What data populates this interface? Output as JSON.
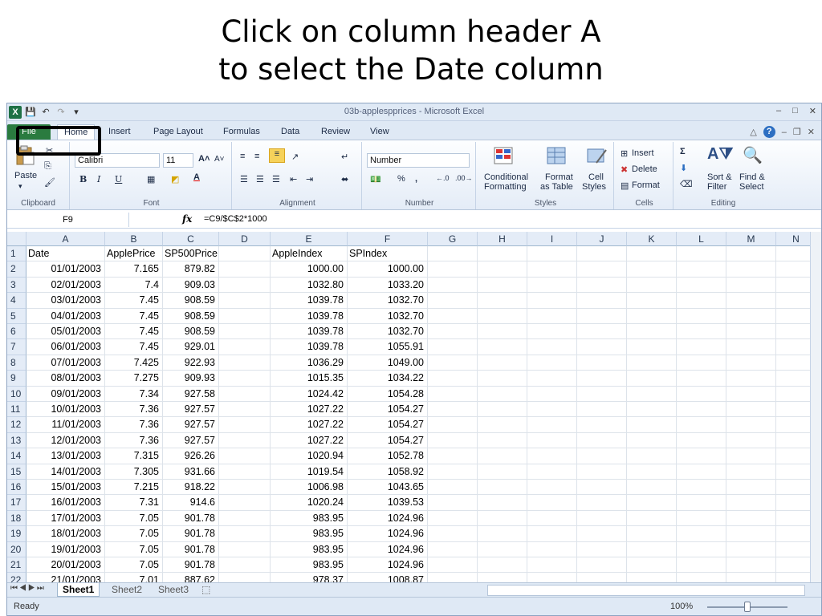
{
  "slide": {
    "line1": "Click on column header A",
    "line2": "to select the Date column"
  },
  "window": {
    "title": "03b-applespprices  -  Microsoft Excel"
  },
  "tabs": [
    "File",
    "Home",
    "Insert",
    "Page Layout",
    "Formulas",
    "Data",
    "Review",
    "View"
  ],
  "ribbon": {
    "clipboard": {
      "paste": "Paste",
      "label": "Clipboard"
    },
    "font": {
      "name": "Calibri",
      "size": "11",
      "bold": "B",
      "italic": "I",
      "underline": "U",
      "label": "Font"
    },
    "alignment": {
      "label": "Alignment"
    },
    "number": {
      "format": "Number",
      "percent": "%",
      "comma": ",",
      "label": "Number"
    },
    "styles": {
      "conditional": "Conditional",
      "formatting": "Formatting",
      "format": "Format",
      "as_table": "as Table",
      "cell": "Cell",
      "styles_word": "Styles",
      "label": "Styles"
    },
    "cells": {
      "insert": "Insert",
      "delete": "Delete",
      "format": "Format",
      "label": "Cells"
    },
    "editing": {
      "sort": "Sort &",
      "filter": "Filter",
      "find": "Find &",
      "select": "Select",
      "label": "Editing"
    }
  },
  "formula_bar": {
    "name_box": "F9",
    "fx": "fx",
    "formula": "=C9/$C$2*1000"
  },
  "columns": [
    "A",
    "B",
    "C",
    "D",
    "E",
    "F",
    "G",
    "H",
    "I",
    "J",
    "K",
    "L",
    "M",
    "N"
  ],
  "header_row": [
    "Date",
    "ApplePrice",
    "SP500Price",
    "",
    "AppleIndex",
    "SPIndex"
  ],
  "rows": [
    [
      "01/01/2003",
      "7.165",
      "879.82",
      "",
      "1000.00",
      "1000.00"
    ],
    [
      "02/01/2003",
      "7.4",
      "909.03",
      "",
      "1032.80",
      "1033.20"
    ],
    [
      "03/01/2003",
      "7.45",
      "908.59",
      "",
      "1039.78",
      "1032.70"
    ],
    [
      "04/01/2003",
      "7.45",
      "908.59",
      "",
      "1039.78",
      "1032.70"
    ],
    [
      "05/01/2003",
      "7.45",
      "908.59",
      "",
      "1039.78",
      "1032.70"
    ],
    [
      "06/01/2003",
      "7.45",
      "929.01",
      "",
      "1039.78",
      "1055.91"
    ],
    [
      "07/01/2003",
      "7.425",
      "922.93",
      "",
      "1036.29",
      "1049.00"
    ],
    [
      "08/01/2003",
      "7.275",
      "909.93",
      "",
      "1015.35",
      "1034.22"
    ],
    [
      "09/01/2003",
      "7.34",
      "927.58",
      "",
      "1024.42",
      "1054.28"
    ],
    [
      "10/01/2003",
      "7.36",
      "927.57",
      "",
      "1027.22",
      "1054.27"
    ],
    [
      "11/01/2003",
      "7.36",
      "927.57",
      "",
      "1027.22",
      "1054.27"
    ],
    [
      "12/01/2003",
      "7.36",
      "927.57",
      "",
      "1027.22",
      "1054.27"
    ],
    [
      "13/01/2003",
      "7.315",
      "926.26",
      "",
      "1020.94",
      "1052.78"
    ],
    [
      "14/01/2003",
      "7.305",
      "931.66",
      "",
      "1019.54",
      "1058.92"
    ],
    [
      "15/01/2003",
      "7.215",
      "918.22",
      "",
      "1006.98",
      "1043.65"
    ],
    [
      "16/01/2003",
      "7.31",
      "914.6",
      "",
      "1020.24",
      "1039.53"
    ],
    [
      "17/01/2003",
      "7.05",
      "901.78",
      "",
      "983.95",
      "1024.96"
    ],
    [
      "18/01/2003",
      "7.05",
      "901.78",
      "",
      "983.95",
      "1024.96"
    ],
    [
      "19/01/2003",
      "7.05",
      "901.78",
      "",
      "983.95",
      "1024.96"
    ],
    [
      "20/01/2003",
      "7.05",
      "901.78",
      "",
      "983.95",
      "1024.96"
    ],
    [
      "21/01/2003",
      "7.01",
      "887.62",
      "",
      "978.37",
      "1008.87"
    ]
  ],
  "sheets": [
    "Sheet1",
    "Sheet2",
    "Sheet3"
  ],
  "status": {
    "ready": "Ready",
    "zoom": "100%"
  },
  "colors": {
    "file_tab": "#2a7b3f",
    "ribbon_bg": "#dfe9f5",
    "highlight": "#000000"
  }
}
